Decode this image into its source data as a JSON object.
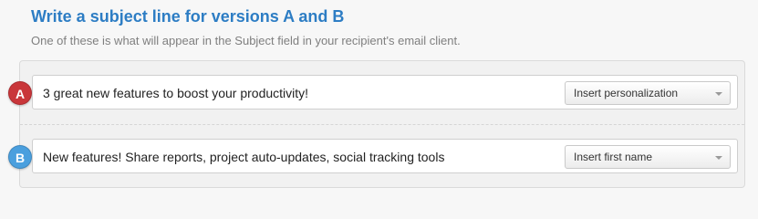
{
  "header": {
    "title": "Write a subject line for versions A and B",
    "subtitle": "One of these is what will appear in the Subject field in your recipient's email client."
  },
  "versions": [
    {
      "badge": "A",
      "badge_color": "#c9363a",
      "subject_value": "3 great new features to boost your productivity!",
      "select_label": "Insert personalization",
      "select_icon": "chevron-down-icon"
    },
    {
      "badge": "B",
      "badge_color": "#4a9fde",
      "subject_value": "New features! Share reports, project auto-updates, social tracking tools",
      "select_label": "Insert first name",
      "select_icon": "chevron-down-icon"
    }
  ],
  "colors": {
    "title": "#2d7dc4",
    "background": "#f7f7f7",
    "panel": "#f1f1f1"
  }
}
